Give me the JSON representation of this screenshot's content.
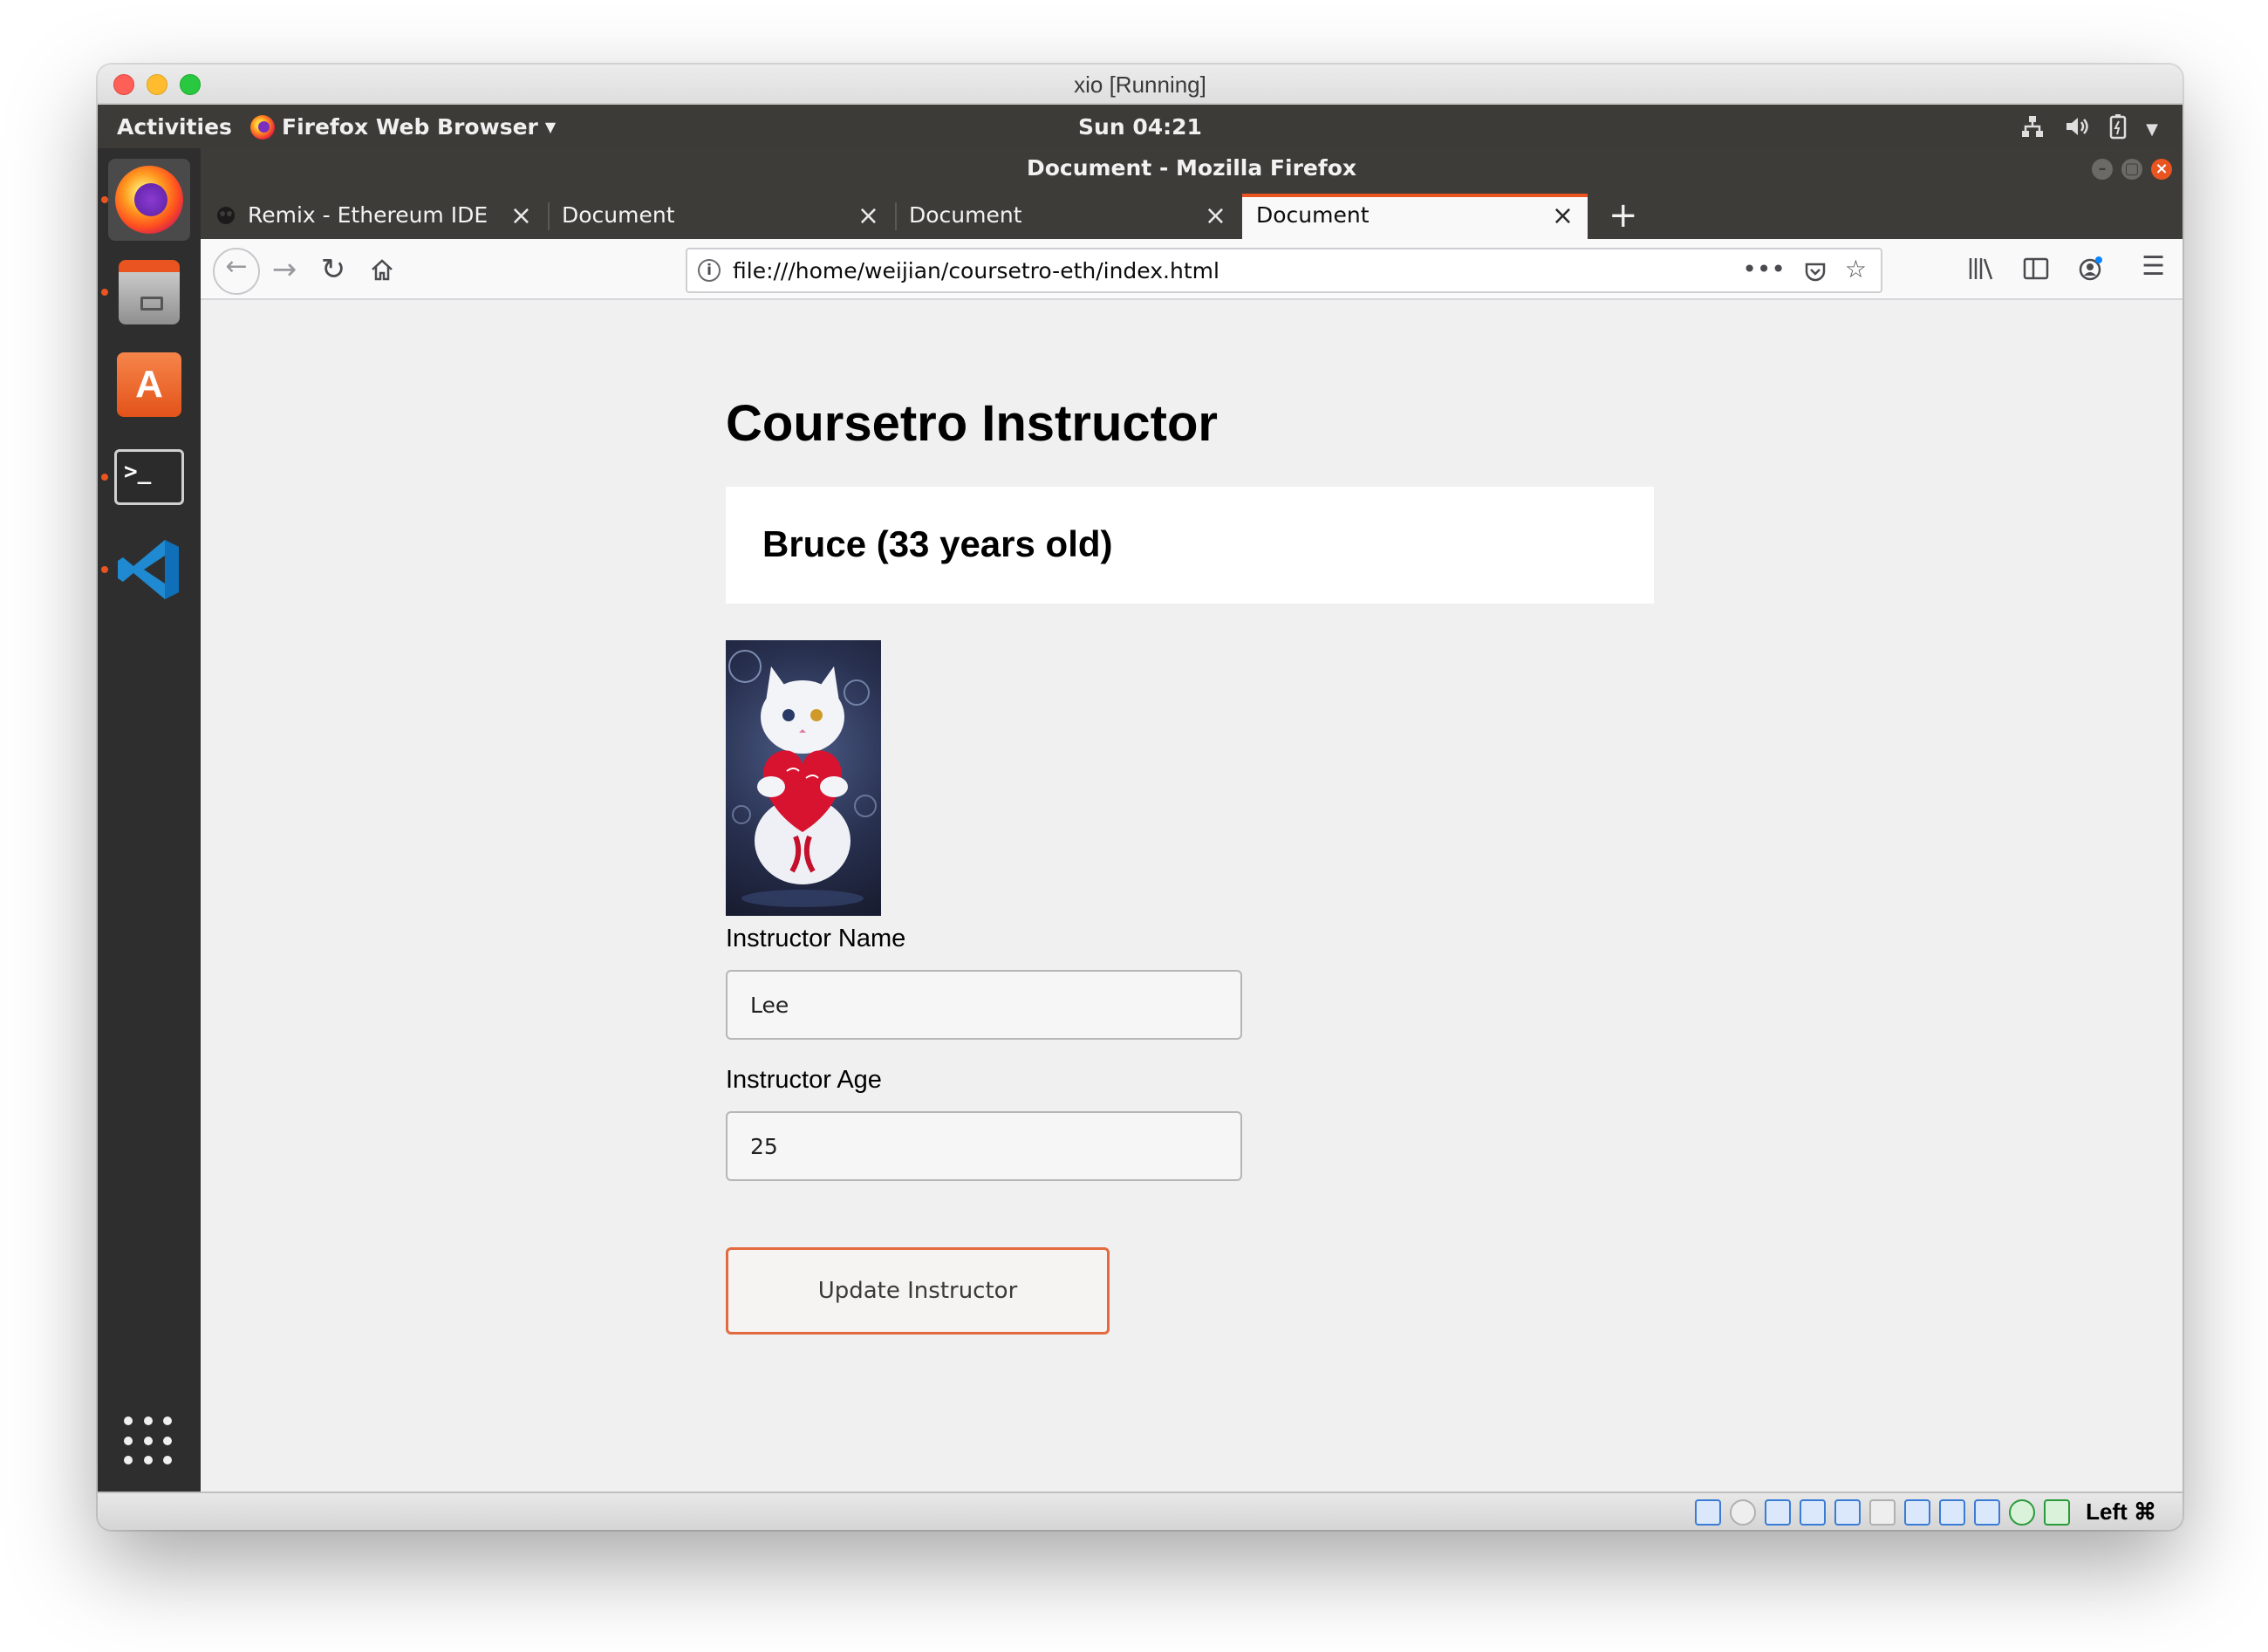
{
  "host": {
    "window_title": "xio [Running]",
    "host_key_label": "Left ⌘"
  },
  "ubuntu": {
    "activities": "Activities",
    "app_menu": "Firefox Web Browser",
    "clock": "Sun 04:21"
  },
  "firefox": {
    "window_title": "Document - Mozilla Firefox",
    "tabs": [
      {
        "label": "Remix - Ethereum IDE"
      },
      {
        "label": "Document"
      },
      {
        "label": "Document"
      },
      {
        "label": "Document"
      }
    ],
    "url": "file:///home/weijian/coursetro-eth/index.html"
  },
  "page": {
    "title": "Coursetro Instructor",
    "instructor_display": "Bruce (33 years old)",
    "name_label": "Instructor Name",
    "name_value": "Lee",
    "age_label": "Instructor Age",
    "age_value": "25",
    "button_label": "Update Instructor"
  },
  "colors": {
    "accent": "#e95420",
    "topbar": "#3c3b37",
    "dock": "#2e2e2e"
  }
}
